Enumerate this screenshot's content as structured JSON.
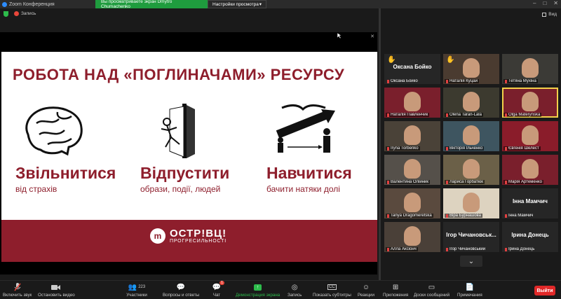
{
  "window": {
    "title": "Zoom Конференция"
  },
  "share_banner": {
    "info": "Вы просматриваете экран Dmytro Chumachenko",
    "options": "Настройки просмотра"
  },
  "meeting_bar": {
    "recording": "Запись",
    "view": "Вид"
  },
  "slide": {
    "title": "РОБОТА НАД «ПОГЛИНАЧАМИ» РЕСУРСУ",
    "columns": [
      {
        "word": "Звільнитися",
        "sub": "від страхів",
        "icon": "brain-icon"
      },
      {
        "word": "Відпустити",
        "sub": "образи, події, людей",
        "icon": "open-door-icon"
      },
      {
        "word": "Навчитися",
        "sub": "бачити натяки долі",
        "icon": "growth-arrow-icon"
      }
    ],
    "footer_brand": "ОСТР!ВЦ!",
    "footer_tagline": "ПРОГРЕСИЛЬНОСТІ",
    "accent": "#8e1e2c"
  },
  "participants": [
    {
      "name": "Оксана Бойко",
      "big": "Оксана Бойко",
      "hand": true
    },
    {
      "name": "Наталія Куцай",
      "hand": true
    },
    {
      "name": "Тетяна Мухіна"
    },
    {
      "name": "Наталія Павленчик"
    },
    {
      "name": "Olena Taran-Lala"
    },
    {
      "name": "Olga Materynska",
      "active": true
    },
    {
      "name": "Iryna Torbenko"
    },
    {
      "name": "Вікторія Ільченко"
    },
    {
      "name": "Євгенія Шелест"
    },
    {
      "name": "Валентина Олійник"
    },
    {
      "name": "Лариса Горбатюк"
    },
    {
      "name": "Марія Артеменко"
    },
    {
      "name": "Tanya Dragomeretska"
    },
    {
      "name": "Віра Бурнашова"
    },
    {
      "name": "Інна Мамчич",
      "big": "Інна Мамчич"
    },
    {
      "name": "Алла Аксіонч"
    },
    {
      "name": "Ігор Чичановський",
      "big": "Ігор Чичановськ..."
    },
    {
      "name": "Ірина Донець",
      "big": "Ірина Донець"
    }
  ],
  "toolbar": {
    "mute": "Включить звук",
    "video": "Остановить видео",
    "participants": "Участники",
    "participants_count": "223",
    "qa": "Вопросы и ответы",
    "chat": "Чат",
    "chat_badge": "1",
    "share": "Демонстрация экрана",
    "record": "Запись",
    "subtitles": "Показать субтитры",
    "reactions": "Реакции",
    "apps": "Приложения",
    "boards": "Доски сообщений",
    "notes": "Примечания",
    "leave": "Выйти"
  }
}
